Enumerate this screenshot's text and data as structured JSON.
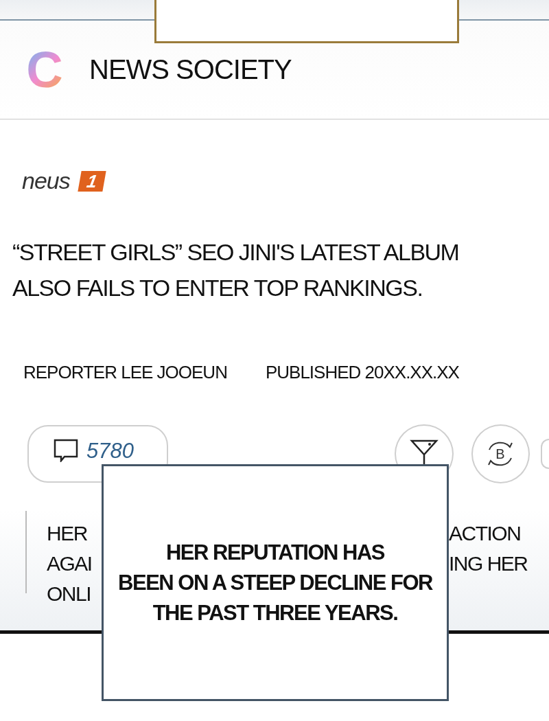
{
  "header": {
    "logo_letter": "C",
    "title": "NEWS SOCIETY"
  },
  "article": {
    "source": {
      "name": "neus",
      "badge": "1"
    },
    "headline": "“STREET GIRLS” SEO JINI'S LATEST ALBUM ALSO FAILS TO ENTER TOP RANKINGS.",
    "byline": [
      {
        "text": "REPORTER LEE JOOEUN"
      },
      {
        "text": "PUBLISHED 20XX.XX.XX"
      }
    ],
    "comments": "5780",
    "actions": [
      {
        "kind": "cocktail"
      },
      {
        "kind": "refresh",
        "label": "B"
      }
    ],
    "body_lines": [
      {
        "left": "HER",
        "right": "ACTION"
      },
      {
        "left": "AGAI",
        "right": "ING HER"
      },
      {
        "left": "ONLI"
      }
    ]
  },
  "captions": [
    {
      "kind": "top"
    },
    {
      "kind": "main",
      "text": "HER REPUTATION HAS\nBEEN ON A STEEP DECLINE FOR\nTHE PAST THREE YEARS."
    }
  ]
}
